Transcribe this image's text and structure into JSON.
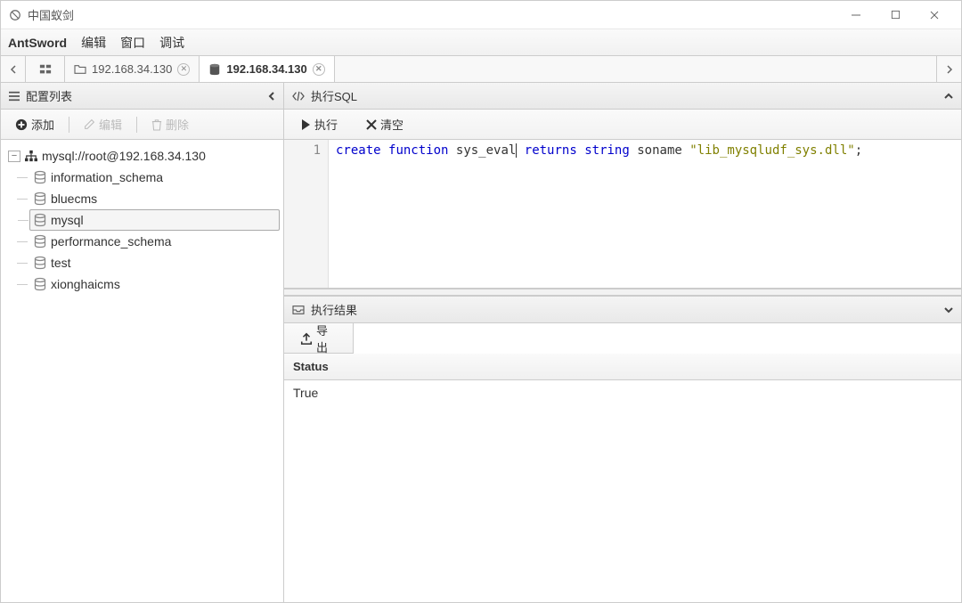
{
  "window": {
    "title": "中国蚁剑"
  },
  "menu": {
    "app": "AntSword",
    "items": [
      "编辑",
      "窗口",
      "调试"
    ]
  },
  "tabs": {
    "items": [
      {
        "label": "192.168.34.130",
        "type": "folder",
        "active": false
      },
      {
        "label": "192.168.34.130",
        "type": "database",
        "active": true
      }
    ]
  },
  "left": {
    "title": "配置列表",
    "toolbar": {
      "add": "添加",
      "edit": "编辑",
      "delete": "删除"
    },
    "tree": {
      "connection": "mysql://root@192.168.34.130",
      "databases": [
        "information_schema",
        "bluecms",
        "mysql",
        "performance_schema",
        "test",
        "xionghaicms"
      ],
      "selected_index": 2
    }
  },
  "right": {
    "sql_panel_title": "执行SQL",
    "toolbar": {
      "execute": "执行",
      "clear": "清空"
    },
    "editor": {
      "line_number": "1",
      "tokens": {
        "t1": "create",
        "t2": "function",
        "t3": "sys_eval",
        "t4": "returns",
        "t5": "string",
        "t6": "soname",
        "t7": "\"lib_mysqludf_sys.dll\"",
        "t8": ";"
      }
    },
    "result_panel_title": "执行结果",
    "result_toolbar": {
      "export": "导出"
    },
    "result": {
      "header": "Status",
      "value": "True"
    }
  }
}
